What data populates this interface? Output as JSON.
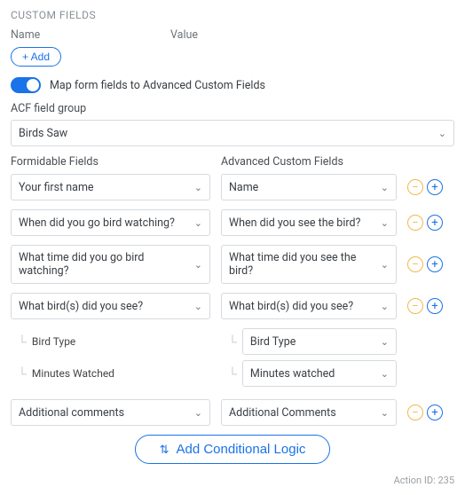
{
  "section_title": "CUSTOM FIELDS",
  "columns": {
    "name": "Name",
    "value": "Value"
  },
  "add_button": "+ Add",
  "toggle": {
    "label": "Map form fields to Advanced Custom Fields",
    "on": true
  },
  "acf_group": {
    "label": "ACF field group",
    "value": "Birds Saw"
  },
  "map_cols": {
    "left": "Formidable Fields",
    "right": "Advanced Custom Fields"
  },
  "rows": [
    {
      "left": "Your first name",
      "right": "Name"
    },
    {
      "left": "When did you go bird watching?",
      "right": "When did you see the bird?"
    },
    {
      "left": "What time did you go bird watching?",
      "right": "What time did you see the bird?"
    },
    {
      "left": "What bird(s) did you see?",
      "right": "What bird(s) did you see?"
    }
  ],
  "sub_rows": [
    {
      "left": "Bird Type",
      "right": "Bird Type"
    },
    {
      "left": "Minutes Watched",
      "right": "Minutes watched"
    }
  ],
  "final_row": {
    "left": "Additional comments",
    "right": "Additional Comments"
  },
  "cond_button": "Add Conditional Logic",
  "footer": "Action ID: 235",
  "glyphs": {
    "minus": "−",
    "plus": "+",
    "chev": "⌄",
    "shuffle": "⇅",
    "tree": "└"
  }
}
